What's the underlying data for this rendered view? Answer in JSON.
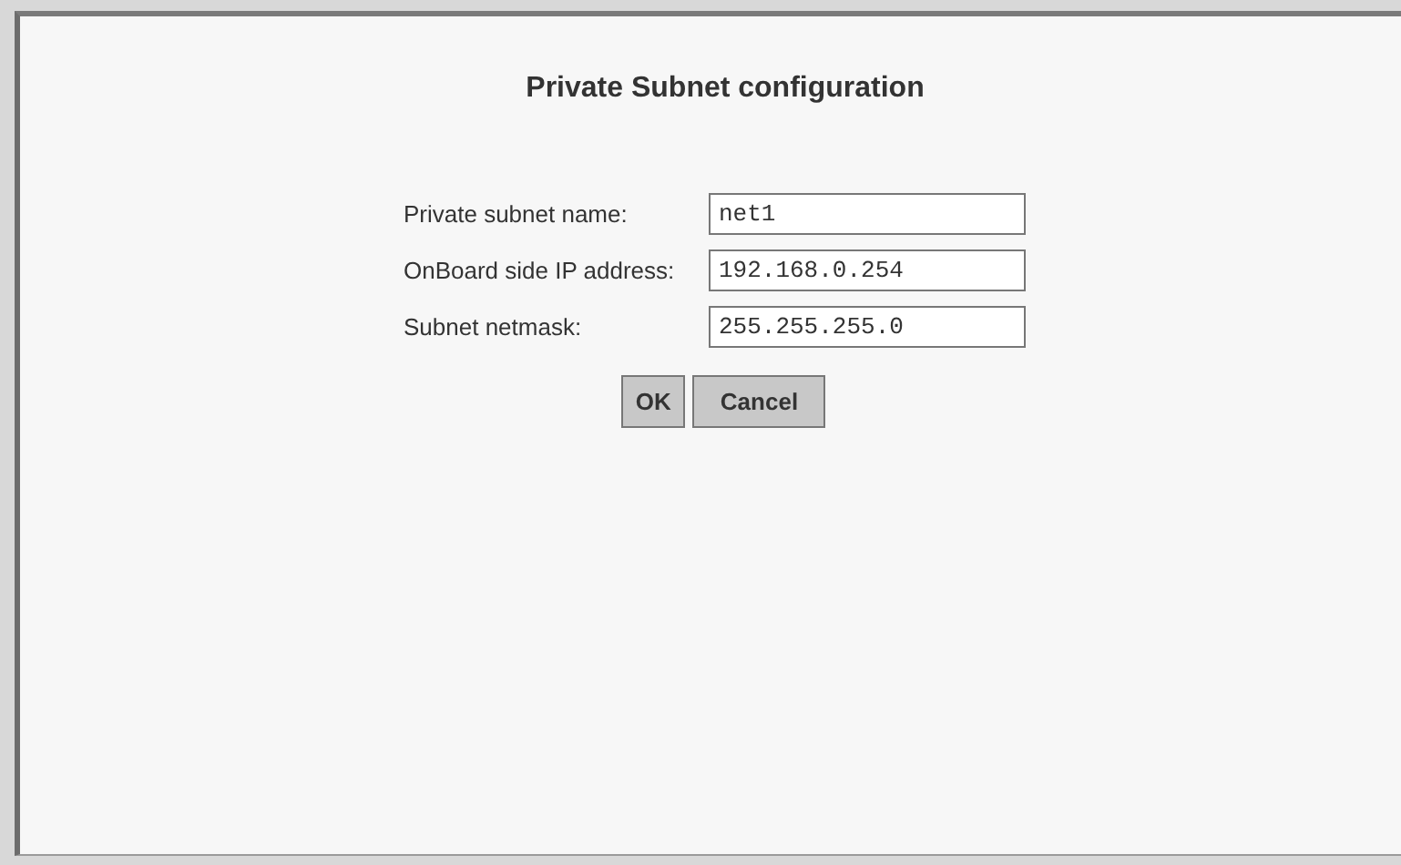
{
  "title": "Private Subnet configuration",
  "fields": [
    {
      "label": "Private subnet name:",
      "value": "net1"
    },
    {
      "label": "OnBoard side IP address:",
      "value": "192.168.0.254"
    },
    {
      "label": "Subnet netmask:",
      "value": "255.255.255.0"
    }
  ],
  "buttons": [
    "OK",
    "Cancel"
  ]
}
